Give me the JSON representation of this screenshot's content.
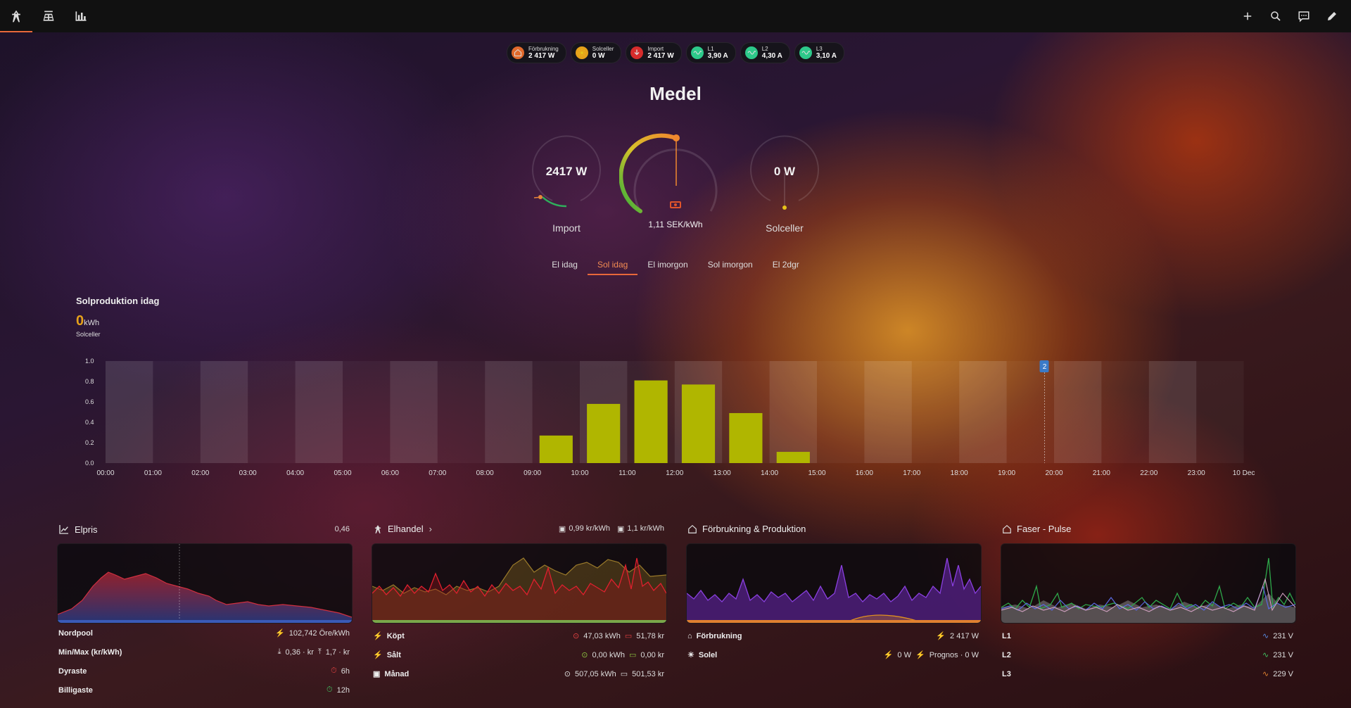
{
  "topbar": {
    "tabs": [
      {
        "name": "energy-tab",
        "icon": "transmission-tower-icon",
        "active": true
      },
      {
        "name": "solar-tab",
        "icon": "solar-panel-icon",
        "active": false
      },
      {
        "name": "stats-tab",
        "icon": "bar-chart-icon",
        "active": false
      }
    ],
    "actions": [
      "plus-icon",
      "search-icon",
      "assist-icon",
      "pencil-icon"
    ]
  },
  "chips": [
    {
      "label": "Förbrukning",
      "value": "2 417 W",
      "icon": "home-icon",
      "color": "#e26a2c"
    },
    {
      "label": "Solceller",
      "value": "0 W",
      "icon": "solar-icon",
      "color": "#e6a21a"
    },
    {
      "label": "Import",
      "value": "2 417 W",
      "icon": "import-icon",
      "color": "#d62c2c"
    },
    {
      "label": "L1",
      "value": "3,90 A",
      "icon": "wave-icon",
      "color": "#2dc98a"
    },
    {
      "label": "L2",
      "value": "4,30 A",
      "icon": "wave-icon",
      "color": "#2dc98a"
    },
    {
      "label": "L3",
      "value": "3,10 A",
      "icon": "wave-icon",
      "color": "#2dc98a"
    }
  ],
  "title": "Medel",
  "gauges": {
    "import": {
      "value": "2417 W",
      "label": "Import"
    },
    "price": {
      "value": "1,11 SEK/kWh",
      "icon": "money-icon"
    },
    "solar": {
      "value": "0 W",
      "label": "Solceller"
    }
  },
  "tabs": [
    {
      "label": "El idag",
      "active": false
    },
    {
      "label": "Sol idag",
      "active": true
    },
    {
      "label": "El imorgon",
      "active": false
    },
    {
      "label": "Sol imorgon",
      "active": false
    },
    {
      "label": "El 2dgr",
      "active": false
    }
  ],
  "solar": {
    "title": "Solproduktion idag",
    "value": "0",
    "unit": "kWh",
    "series_label": "Solceller",
    "now_marker": "2"
  },
  "chart_data": {
    "type": "bar",
    "categories": [
      "00:00",
      "01:00",
      "02:00",
      "03:00",
      "04:00",
      "05:00",
      "06:00",
      "07:00",
      "08:00",
      "09:00",
      "10:00",
      "11:00",
      "12:00",
      "13:00",
      "14:00",
      "15:00",
      "16:00",
      "17:00",
      "18:00",
      "19:00",
      "20:00",
      "21:00",
      "22:00",
      "23:00"
    ],
    "x_end_label": "10 Dec",
    "values": [
      0,
      0,
      0,
      0,
      0,
      0,
      0,
      0,
      0,
      0.27,
      0.58,
      0.81,
      0.77,
      0.49,
      0.11,
      0,
      0,
      0,
      0,
      0,
      0,
      0,
      0,
      0
    ],
    "yticks": [
      "0.0",
      "0.2",
      "0.4",
      "0.6",
      "0.8",
      "1.0"
    ],
    "ylim": [
      0,
      1.0
    ],
    "bar_color": "#b0b600",
    "now_index": 19.8
  },
  "cards": {
    "elpris": {
      "title": "Elpris",
      "value": "0,46",
      "rows": [
        {
          "label": "Nordpool",
          "value": "102,742 Öre/kWh"
        },
        {
          "label": "Min/Max (kr/kWh)",
          "min": "0,36 · kr",
          "max": "1,7 · kr"
        },
        {
          "label": "Dyraste",
          "value": "6h"
        },
        {
          "label": "Billigaste",
          "value": "12h"
        }
      ]
    },
    "elhandel": {
      "title": "Elhandel",
      "stat1": "0,99 kr/kWh",
      "stat2": "1,1 kr/kWh",
      "rows": [
        {
          "label": "Köpt",
          "a": "47,03 kWh",
          "b": "51,78 kr"
        },
        {
          "label": "Sålt",
          "a": "0,00 kWh",
          "b": "0,00 kr"
        },
        {
          "label": "Månad",
          "a": "507,05 kWh",
          "b": "501,53 kr"
        }
      ]
    },
    "forbrukning": {
      "title": "Förbrukning & Produktion",
      "rows": [
        {
          "label": "Förbrukning",
          "value": "2 417 W"
        },
        {
          "label": "Solel",
          "value": "0 W",
          "extra": "Prognos · 0 W"
        }
      ]
    },
    "faser": {
      "title": "Faser - Pulse",
      "rows": [
        {
          "label": "L1",
          "value": "231 V"
        },
        {
          "label": "L2",
          "value": "231 V"
        },
        {
          "label": "L3",
          "value": "229 V"
        }
      ]
    }
  }
}
